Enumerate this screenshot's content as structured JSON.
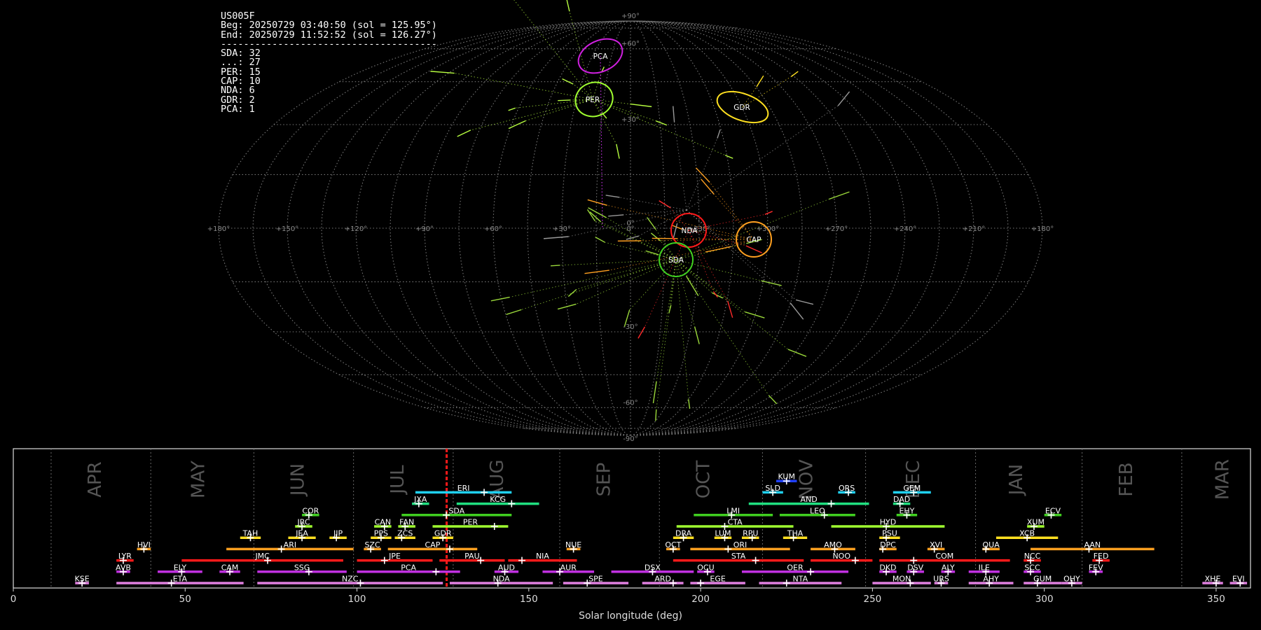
{
  "station": "US005F",
  "begin": "Beg: 20250729 03:40:50 (sol = 125.95°)",
  "end": "End: 20250729 11:52:52 (sol = 126.27°)",
  "separator": "--------------------------------------",
  "counts": [
    {
      "name": "SDA",
      "count": 32
    },
    {
      "name": "...",
      "count": 27
    },
    {
      "name": "PER",
      "count": 15
    },
    {
      "name": "CAP",
      "count": 10
    },
    {
      "name": "NDA",
      "count": 6
    },
    {
      "name": "GDR",
      "count": 2
    },
    {
      "name": "PCA",
      "count": 1
    }
  ],
  "sky_map": {
    "lat_labels": [
      "+90°",
      "+60°",
      "+30°",
      "0°",
      "-30°",
      "-60°",
      "-90°"
    ],
    "lon_labels": [
      "+180°",
      "+150°",
      "+120°",
      "+90°",
      "+60°",
      "+30°",
      "0°",
      "+330°",
      "+300°",
      "+270°",
      "+240°",
      "+210°",
      "+180°"
    ],
    "radiants": [
      {
        "name": "PCA",
        "color": "#d020e0"
      },
      {
        "name": "PER",
        "color": "#a0ff30"
      },
      {
        "name": "GDR",
        "color": "#ffe020"
      },
      {
        "name": "NDA",
        "color": "#ff1a1a"
      },
      {
        "name": "CAP",
        "color": "#ffa020"
      },
      {
        "name": "SDA",
        "color": "#40d020"
      }
    ]
  },
  "chart_data": {
    "type": "timeline",
    "xlabel": "Solar longitude (deg)",
    "xlim": [
      0,
      360
    ],
    "x_ticks": [
      0,
      50,
      100,
      150,
      200,
      250,
      300,
      350
    ],
    "current_sol": 126.1,
    "month_boundaries": [
      11,
      40,
      70,
      99,
      128,
      159,
      188,
      218,
      248,
      280,
      311,
      340
    ],
    "months": [
      {
        "name": "APR",
        "sol": 24
      },
      {
        "name": "MAY",
        "sol": 54
      },
      {
        "name": "JUN",
        "sol": 83
      },
      {
        "name": "JUL",
        "sol": 112
      },
      {
        "name": "AUG",
        "sol": 141
      },
      {
        "name": "SEP",
        "sol": 172
      },
      {
        "name": "OCT",
        "sol": 201
      },
      {
        "name": "NOV",
        "sol": 231
      },
      {
        "name": "DEC",
        "sol": 262
      },
      {
        "name": "JAN",
        "sol": 292
      },
      {
        "name": "FEB",
        "sol": 324
      },
      {
        "name": "MAR",
        "sol": 352
      }
    ],
    "showers": [
      {
        "code": "KUM",
        "row": 9,
        "start": 222,
        "end": 228,
        "peak": 225,
        "color": "#2040ff"
      },
      {
        "code": "ERI",
        "row": 8,
        "start": 117,
        "end": 145,
        "peak": 137,
        "color": "#20d0f0"
      },
      {
        "code": "SLD",
        "row": 8,
        "start": 218,
        "end": 224,
        "peak": 221,
        "color": "#20d0f0"
      },
      {
        "code": "ORS",
        "row": 8,
        "start": 240,
        "end": 245,
        "peak": 243,
        "color": "#20d0f0"
      },
      {
        "code": "GEM",
        "row": 8,
        "start": 256,
        "end": 267,
        "peak": 262,
        "color": "#20d0f0"
      },
      {
        "code": "JXA",
        "row": 7,
        "start": 116,
        "end": 121,
        "peak": 118,
        "color": "#20e080"
      },
      {
        "code": "KCG",
        "row": 7,
        "start": 129,
        "end": 153,
        "peak": 145,
        "color": "#20e080"
      },
      {
        "code": "AND",
        "row": 7,
        "start": 214,
        "end": 249,
        "peak": 238,
        "color": "#20e080"
      },
      {
        "code": "DAD",
        "row": 7,
        "start": 256,
        "end": 261,
        "peak": 258,
        "color": "#20e080"
      },
      {
        "code": "COR",
        "row": 6,
        "start": 84,
        "end": 89,
        "peak": 86,
        "color": "#40d020"
      },
      {
        "code": "SDA",
        "row": 6,
        "start": 113,
        "end": 145,
        "peak": 126,
        "color": "#40d020"
      },
      {
        "code": "LMI",
        "row": 6,
        "start": 198,
        "end": 221,
        "peak": 209,
        "color": "#40d020"
      },
      {
        "code": "LEO",
        "row": 6,
        "start": 223,
        "end": 245,
        "peak": 236,
        "color": "#40d020"
      },
      {
        "code": "EHY",
        "row": 6,
        "start": 257,
        "end": 263,
        "peak": 260,
        "color": "#40d020"
      },
      {
        "code": "ECV",
        "row": 6,
        "start": 300,
        "end": 305,
        "peak": 302,
        "color": "#40d020"
      },
      {
        "code": "JRC",
        "row": 5,
        "start": 82,
        "end": 87,
        "peak": 84,
        "color": "#a0ff30"
      },
      {
        "code": "CAN",
        "row": 5,
        "start": 105,
        "end": 110,
        "peak": 108,
        "color": "#a0ff30"
      },
      {
        "code": "FAN",
        "row": 5,
        "start": 112,
        "end": 117,
        "peak": 114,
        "color": "#a0ff30"
      },
      {
        "code": "PER",
        "row": 5,
        "start": 122,
        "end": 144,
        "peak": 140,
        "color": "#a0ff30"
      },
      {
        "code": "CTA",
        "row": 5,
        "start": 193,
        "end": 227,
        "peak": 207,
        "color": "#a0ff30"
      },
      {
        "code": "HYD",
        "row": 5,
        "start": 238,
        "end": 271,
        "peak": 254,
        "color": "#a0ff30"
      },
      {
        "code": "XUM",
        "row": 5,
        "start": 295,
        "end": 300,
        "peak": 297,
        "color": "#a0ff30"
      },
      {
        "code": "TAH",
        "row": 4,
        "start": 66,
        "end": 72,
        "peak": 69,
        "color": "#ffe020"
      },
      {
        "code": "JEA",
        "row": 4,
        "start": 80,
        "end": 88,
        "peak": 84,
        "color": "#ffe020"
      },
      {
        "code": "JIP",
        "row": 4,
        "start": 92,
        "end": 97,
        "peak": 94,
        "color": "#ffe020"
      },
      {
        "code": "PPS",
        "row": 4,
        "start": 104,
        "end": 110,
        "peak": 107,
        "color": "#ffe020"
      },
      {
        "code": "ZCS",
        "row": 4,
        "start": 111,
        "end": 117,
        "peak": 113,
        "color": "#ffe020"
      },
      {
        "code": "GDR",
        "row": 4,
        "start": 122,
        "end": 128,
        "peak": 125,
        "color": "#ffe020"
      },
      {
        "code": "DRA",
        "row": 4,
        "start": 192,
        "end": 198,
        "peak": 195,
        "color": "#ffe020"
      },
      {
        "code": "LUM",
        "row": 4,
        "start": 204,
        "end": 209,
        "peak": 207,
        "color": "#ffe020"
      },
      {
        "code": "RPU",
        "row": 4,
        "start": 212,
        "end": 217,
        "peak": 215,
        "color": "#ffe020"
      },
      {
        "code": "THA",
        "row": 4,
        "start": 224,
        "end": 231,
        "peak": 227,
        "color": "#ffe020"
      },
      {
        "code": "PSU",
        "row": 4,
        "start": 252,
        "end": 258,
        "peak": 254,
        "color": "#ffe020"
      },
      {
        "code": "XCB",
        "row": 4,
        "start": 286,
        "end": 304,
        "peak": 295,
        "color": "#ffe020"
      },
      {
        "code": "HVI",
        "row": 3,
        "start": 36,
        "end": 40,
        "peak": 38,
        "color": "#ffa020"
      },
      {
        "code": "ARI",
        "row": 3,
        "start": 62,
        "end": 99,
        "peak": 78,
        "color": "#ffa020"
      },
      {
        "code": "SZC",
        "row": 3,
        "start": 102,
        "end": 107,
        "peak": 104,
        "color": "#ffa020"
      },
      {
        "code": "CAP",
        "row": 3,
        "start": 109,
        "end": 135,
        "peak": 127,
        "color": "#ffa020"
      },
      {
        "code": "NUE",
        "row": 3,
        "start": 161,
        "end": 165,
        "peak": 163,
        "color": "#ffa020"
      },
      {
        "code": "OCT",
        "row": 3,
        "start": 190,
        "end": 194,
        "peak": 192,
        "color": "#ffa020"
      },
      {
        "code": "ORI",
        "row": 3,
        "start": 197,
        "end": 226,
        "peak": 208,
        "color": "#ffa020"
      },
      {
        "code": "AMO",
        "row": 3,
        "start": 232,
        "end": 245,
        "peak": 239,
        "color": "#ffa020"
      },
      {
        "code": "DPC",
        "row": 3,
        "start": 252,
        "end": 257,
        "peak": 253,
        "color": "#ffa020"
      },
      {
        "code": "XVI",
        "row": 3,
        "start": 266,
        "end": 271,
        "peak": 268,
        "color": "#ffa020"
      },
      {
        "code": "QUA",
        "row": 3,
        "start": 282,
        "end": 287,
        "peak": 283,
        "color": "#ffa020"
      },
      {
        "code": "AAN",
        "row": 3,
        "start": 296,
        "end": 332,
        "peak": 313,
        "color": "#ffa020"
      },
      {
        "code": "LYR",
        "row": 2,
        "start": 30,
        "end": 35,
        "peak": 32,
        "color": "#ff1a1a"
      },
      {
        "code": "JMC",
        "row": 2,
        "start": 49,
        "end": 96,
        "peak": 74,
        "color": "#ff1a1a"
      },
      {
        "code": "JPE",
        "row": 2,
        "start": 100,
        "end": 122,
        "peak": 108,
        "color": "#ff1a1a"
      },
      {
        "code": "PAU",
        "row": 2,
        "start": 124,
        "end": 143,
        "peak": 136,
        "color": "#ff1a1a"
      },
      {
        "code": "NIA",
        "row": 2,
        "start": 144,
        "end": 164,
        "peak": 148,
        "color": "#ff1a1a"
      },
      {
        "code": "STA",
        "row": 2,
        "start": 192,
        "end": 230,
        "peak": 216,
        "color": "#ff1a1a"
      },
      {
        "code": "NOO",
        "row": 2,
        "start": 232,
        "end": 250,
        "peak": 245,
        "color": "#ff1a1a"
      },
      {
        "code": "COM",
        "row": 2,
        "start": 252,
        "end": 290,
        "peak": 262,
        "color": "#ff1a1a"
      },
      {
        "code": "NCC",
        "row": 2,
        "start": 294,
        "end": 299,
        "peak": 296,
        "color": "#ff1a1a"
      },
      {
        "code": "FED",
        "row": 2,
        "start": 314,
        "end": 319,
        "peak": 316,
        "color": "#ff1a1a"
      },
      {
        "code": "AVB",
        "row": 1,
        "start": 30,
        "end": 34,
        "peak": 32,
        "color": "#c030e0"
      },
      {
        "code": "ELY",
        "row": 1,
        "start": 42,
        "end": 55,
        "peak": 49,
        "color": "#c030e0"
      },
      {
        "code": "CAM",
        "row": 1,
        "start": 60,
        "end": 66,
        "peak": 63,
        "color": "#c030e0"
      },
      {
        "code": "SSG",
        "row": 1,
        "start": 71,
        "end": 97,
        "peak": 86,
        "color": "#c030e0"
      },
      {
        "code": "PCA",
        "row": 1,
        "start": 100,
        "end": 130,
        "peak": 123,
        "color": "#c030e0"
      },
      {
        "code": "AUD",
        "row": 1,
        "start": 140,
        "end": 147,
        "peak": 143,
        "color": "#c030e0"
      },
      {
        "code": "AUR",
        "row": 1,
        "start": 154,
        "end": 169,
        "peak": 159,
        "color": "#c030e0"
      },
      {
        "code": "DSX",
        "row": 1,
        "start": 174,
        "end": 198,
        "peak": 186,
        "color": "#c030e0"
      },
      {
        "code": "OCU",
        "row": 1,
        "start": 199,
        "end": 204,
        "peak": 202,
        "color": "#c030e0"
      },
      {
        "code": "OER",
        "row": 1,
        "start": 212,
        "end": 243,
        "peak": 232,
        "color": "#c030e0"
      },
      {
        "code": "DKD",
        "row": 1,
        "start": 252,
        "end": 257,
        "peak": 254,
        "color": "#c030e0"
      },
      {
        "code": "DSV",
        "row": 1,
        "start": 260,
        "end": 265,
        "peak": 262,
        "color": "#c030e0"
      },
      {
        "code": "ALY",
        "row": 1,
        "start": 270,
        "end": 274,
        "peak": 272,
        "color": "#c030e0"
      },
      {
        "code": "ILE",
        "row": 1,
        "start": 278,
        "end": 287,
        "peak": 283,
        "color": "#c030e0"
      },
      {
        "code": "SCC",
        "row": 1,
        "start": 294,
        "end": 299,
        "peak": 296,
        "color": "#c030e0"
      },
      {
        "code": "FEV",
        "row": 1,
        "start": 313,
        "end": 317,
        "peak": 315,
        "color": "#c030e0"
      },
      {
        "code": "KSE",
        "row": 0,
        "start": 18,
        "end": 22,
        "peak": 20,
        "color": "#e080e0"
      },
      {
        "code": "ETA",
        "row": 0,
        "start": 30,
        "end": 67,
        "peak": 46,
        "color": "#e080e0"
      },
      {
        "code": "NZC",
        "row": 0,
        "start": 71,
        "end": 125,
        "peak": 101,
        "color": "#e080e0"
      },
      {
        "code": "NDA",
        "row": 0,
        "start": 127,
        "end": 157,
        "peak": 141,
        "color": "#e080e0"
      },
      {
        "code": "SPE",
        "row": 0,
        "start": 160,
        "end": 179,
        "peak": 167,
        "color": "#e080e0"
      },
      {
        "code": "ARD",
        "row": 0,
        "start": 183,
        "end": 195,
        "peak": 192,
        "color": "#e080e0"
      },
      {
        "code": "EGE",
        "row": 0,
        "start": 197,
        "end": 213,
        "peak": 200,
        "color": "#e080e0"
      },
      {
        "code": "NTA",
        "row": 0,
        "start": 217,
        "end": 241,
        "peak": 225,
        "color": "#e080e0"
      },
      {
        "code": "MON",
        "row": 0,
        "start": 250,
        "end": 267,
        "peak": 261,
        "color": "#e080e0"
      },
      {
        "code": "URS",
        "row": 0,
        "start": 268,
        "end": 272,
        "peak": 270,
        "color": "#e080e0"
      },
      {
        "code": "AHY",
        "row": 0,
        "start": 278,
        "end": 291,
        "peak": 284,
        "color": "#e080e0"
      },
      {
        "code": "GUM",
        "row": 0,
        "start": 294,
        "end": 305,
        "peak": 298,
        "color": "#e080e0"
      },
      {
        "code": "OHY",
        "row": 0,
        "start": 305,
        "end": 311,
        "peak": 308,
        "color": "#e080e0"
      },
      {
        "code": "XHE",
        "row": 0,
        "start": 346,
        "end": 352,
        "peak": 350,
        "color": "#e080e0"
      },
      {
        "code": "EVI",
        "row": 0,
        "start": 354,
        "end": 359,
        "peak": 357,
        "color": "#e080e0"
      }
    ]
  }
}
